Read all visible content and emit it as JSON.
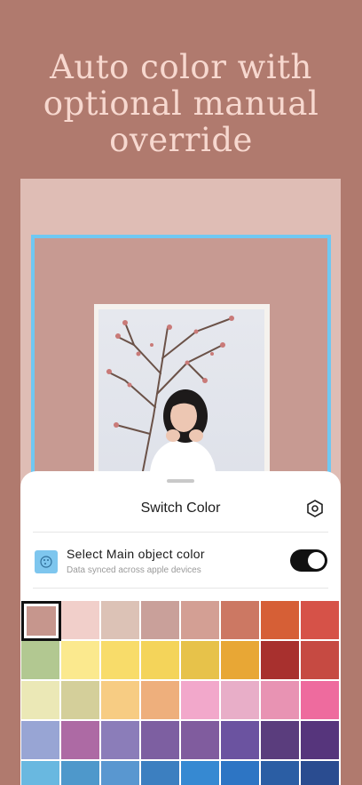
{
  "headline": {
    "line1": "Auto color with",
    "line2": "optional manual",
    "line3": "override"
  },
  "sheet": {
    "title": "Switch Color",
    "option": {
      "title": "Select Main object color",
      "subtitle": "Data synced across apple devices",
      "toggle_on": true
    }
  },
  "colors": {
    "background": "#b07a6e",
    "preview_bg": "#dfbdb5",
    "frame_border": "#6fc8f2",
    "headline_text": "#f7d8cf"
  },
  "palette": [
    [
      "#c6968d",
      "#f1cfca",
      "#dcc2b6",
      "#c9a09a",
      "#d39f94",
      "#cc7863",
      "#d65f36",
      "#d65248"
    ],
    [
      "#b2c891",
      "#fbe98e",
      "#f8dc6a",
      "#f4d45a",
      "#e7c24a",
      "#e8a735",
      "#a8302e",
      "#c64a42"
    ],
    [
      "#ebe8b6",
      "#d4cf9a",
      "#f7cc83",
      "#eeaf7c",
      "#f2a8cb",
      "#e8aec8",
      "#e893b3",
      "#ee6b9e"
    ],
    [
      "#98a5d4",
      "#ad6aa4",
      "#8b7db9",
      "#7d5fa1",
      "#805c9e",
      "#6b53a0",
      "#5a3d7d",
      "#56357c"
    ],
    [
      "#69b8e0",
      "#4e98cb",
      "#5997d0",
      "#3c7fc0",
      "#3689d2",
      "#2d75c4",
      "#2b5ea4",
      "#2a4c90"
    ]
  ],
  "selected_swatch": "0.0"
}
